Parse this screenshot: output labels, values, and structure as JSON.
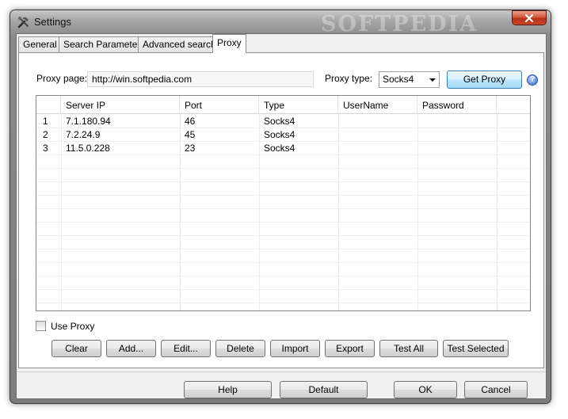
{
  "window": {
    "title": "Settings",
    "watermark": "SOFTPEDIA"
  },
  "tabs": [
    {
      "label": "General",
      "active": false
    },
    {
      "label": "Search Parameters",
      "active": false
    },
    {
      "label": "Advanced search",
      "active": false
    },
    {
      "label": "Proxy",
      "active": true
    }
  ],
  "proxy": {
    "page_label": "Proxy page:",
    "page_value": "http://win.softpedia.com",
    "type_label": "Proxy type:",
    "type_value": "Socks4",
    "get_proxy_label": "Get Proxy",
    "help_glyph": "?"
  },
  "table": {
    "columns": [
      "",
      "Server IP",
      "Port",
      "Type",
      "UserName",
      "Password"
    ],
    "rows": [
      {
        "num": "1",
        "ip": "7.1.180.94",
        "port": "46",
        "type": "Socks4",
        "user": "",
        "password": ""
      },
      {
        "num": "2",
        "ip": "7.2.24.9",
        "port": "45",
        "type": "Socks4",
        "user": "",
        "password": ""
      },
      {
        "num": "3",
        "ip": "11.5.0.228",
        "port": "23",
        "type": "Socks4",
        "user": "",
        "password": ""
      }
    ]
  },
  "use_proxy": {
    "label": "Use Proxy",
    "checked": false
  },
  "actions": {
    "clear": "Clear",
    "add": "Add...",
    "edit": "Edit...",
    "delete": "Delete",
    "import": "Import",
    "export": "Export",
    "test_all": "Test All",
    "test_selected": "Test Selected"
  },
  "footer": {
    "help": "Help",
    "default": "Default",
    "ok": "OK",
    "cancel": "Cancel"
  },
  "icons": {
    "title": "tools-icon",
    "close": "close-icon",
    "help": "help-icon",
    "dropdown": "chevron-down-icon"
  },
  "colors": {
    "close_button": "#c8462a",
    "accent_button": "#3c7fb1",
    "help_icon": "#3d6fc4"
  }
}
